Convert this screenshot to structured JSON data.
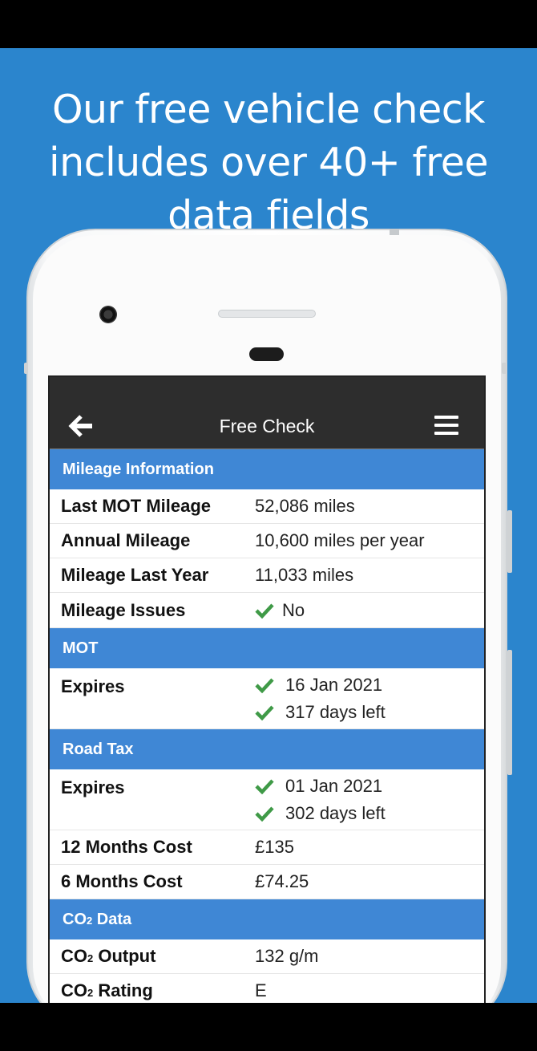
{
  "headline": {
    "line1": "Our free vehicle check",
    "line2": "includes over 40+ free",
    "line3": "data fields"
  },
  "app_bar": {
    "title": "Free Check",
    "back_icon": "back-arrow-icon",
    "menu_icon": "hamburger-menu-icon"
  },
  "colors": {
    "background": "#2b85cd",
    "section_header": "#3f87d5",
    "app_bar": "#2d2d2d",
    "check": "#3f9a47"
  },
  "sections": {
    "mileage": {
      "title": "Mileage Information",
      "rows": [
        {
          "label": "Last MOT Mileage",
          "value": "52,086 miles"
        },
        {
          "label": "Annual Mileage",
          "value": "10,600 miles per year"
        },
        {
          "label": "Mileage Last Year",
          "value": "11,033 miles"
        },
        {
          "label": "Mileage Issues",
          "value": "No"
        }
      ]
    },
    "mot": {
      "title": "MOT",
      "rows": [
        {
          "label": "Expires",
          "value_date": "16 Jan 2021",
          "value_days": "317 days left"
        }
      ]
    },
    "road_tax": {
      "title": "Road Tax",
      "rows": [
        {
          "label": "Expires",
          "value_date": "01 Jan 2021",
          "value_days": "302 days left"
        },
        {
          "label": "12 Months Cost",
          "value": "£135"
        },
        {
          "label": "6 Months Cost",
          "value": "£74.25"
        }
      ]
    },
    "co2": {
      "title_prefix": "CO",
      "title_sub": "2",
      "title_suffix": " Data",
      "rows": [
        {
          "label_prefix": "CO",
          "label_sub": "2",
          "label_suffix": " Output",
          "value": "132 g/m"
        },
        {
          "label_prefix": "CO",
          "label_sub": "2",
          "label_suffix": " Rating",
          "value": "E"
        }
      ]
    }
  }
}
